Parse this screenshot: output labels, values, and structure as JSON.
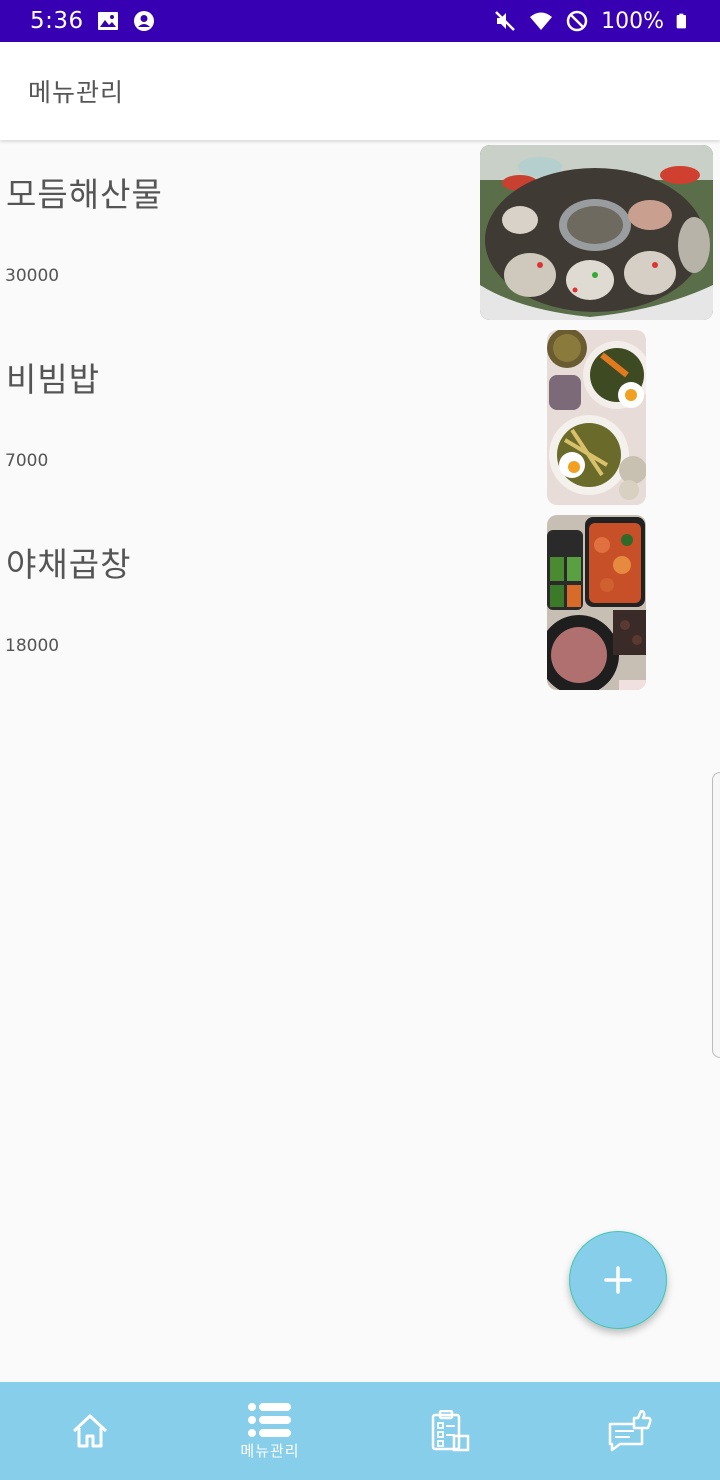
{
  "status_bar": {
    "time": "5:36",
    "battery": "100%",
    "left_icons": [
      "image-icon",
      "account-circle-icon"
    ],
    "right_icons": [
      "mute-icon",
      "wifi-icon",
      "do-not-disturb-icon",
      "battery-icon"
    ]
  },
  "app_bar": {
    "title": "메뉴관리"
  },
  "menu": [
    {
      "name": "모듬해산물",
      "price": "30000",
      "photo": "seafood-platter-photo"
    },
    {
      "name": "비빔밥",
      "price": "7000",
      "photo": "bibimbap-photo"
    },
    {
      "name": "야채곱창",
      "price": "18000",
      "photo": "gopchang-photo"
    }
  ],
  "fab": {
    "icon": "plus-icon"
  },
  "bottom_nav": {
    "items": [
      {
        "icon": "home-icon",
        "label": ""
      },
      {
        "icon": "list-icon",
        "label": "메뉴관리",
        "active": true
      },
      {
        "icon": "clipboard-icon",
        "label": ""
      },
      {
        "icon": "review-thumbs-up-icon",
        "label": ""
      }
    ]
  },
  "colors": {
    "status_bar": "#3700b3",
    "accent": "#87ceeb",
    "background": "#fafafa"
  }
}
